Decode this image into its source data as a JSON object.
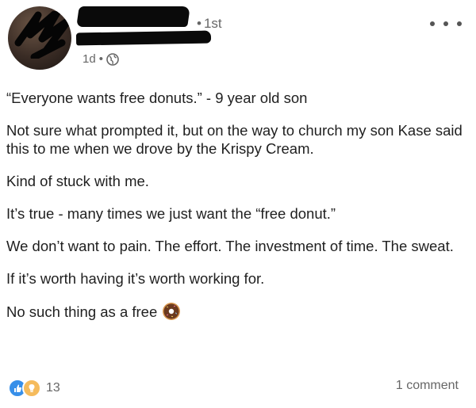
{
  "header": {
    "connection_degree": "1st",
    "post_age": "1d",
    "separator": "•",
    "visibility_icon": "globe-icon",
    "more_icon": "ellipsis-icon"
  },
  "post": {
    "paragraphs": [
      "“Everyone wants free donuts.” - 9 year old son",
      "Not sure what prompted it, but on the way to church my son Kase said this to me when we drove by the Krispy Cream.",
      "Kind of stuck with me.",
      "It’s true - many times we just want the “free donut.”",
      "We don’t want to pain. The effort. The investment of time. The sweat.",
      "If it’s worth having it’s worth working for."
    ],
    "closing_text": "No such thing as a free",
    "closing_emoji": "donut-emoji"
  },
  "footer": {
    "reaction_icons": [
      "like-icon",
      "insightful-icon"
    ],
    "reaction_count": "13",
    "comments_label": "1 comment"
  },
  "colors": {
    "like_blue": "#378fe9",
    "insight_yellow": "#f5bb5c",
    "meta_gray": "#666666"
  }
}
